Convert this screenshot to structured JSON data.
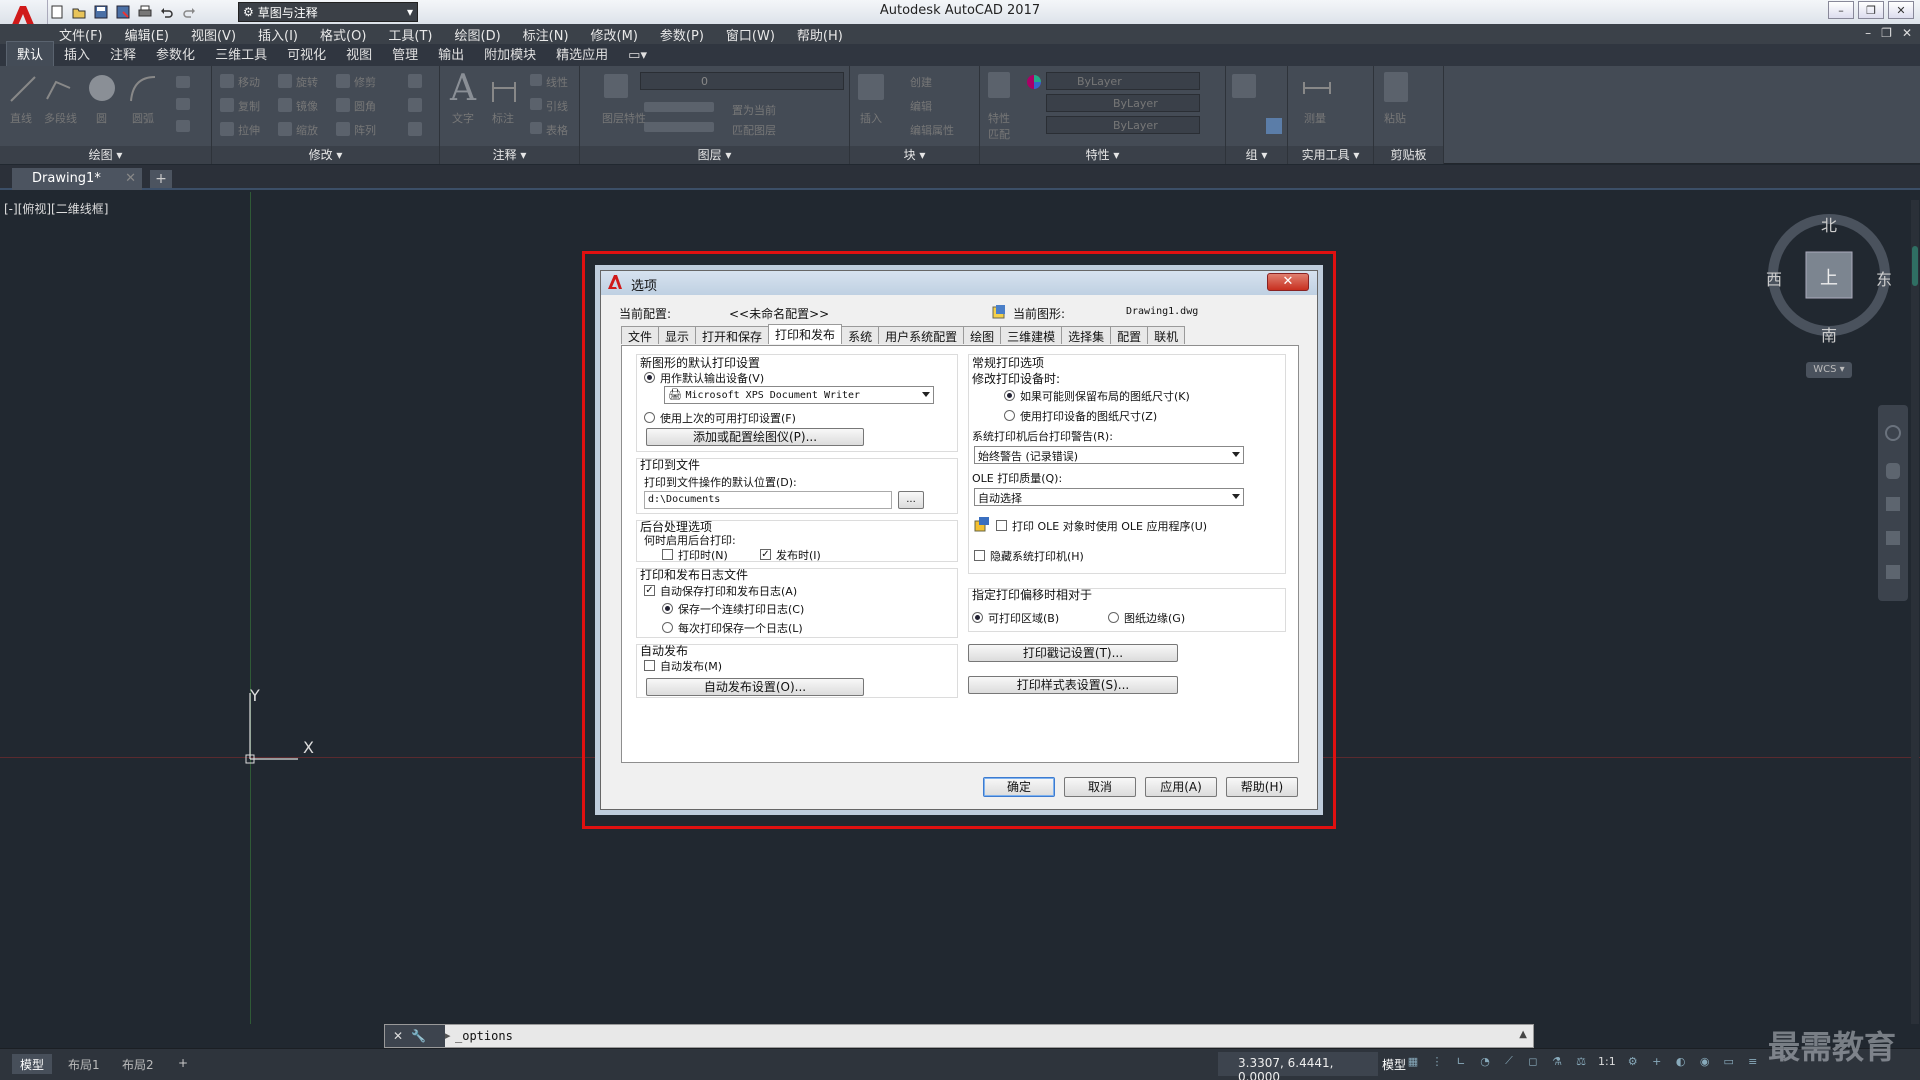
{
  "app": {
    "title": "Autodesk AutoCAD 2017",
    "workspace": "草图与注释"
  },
  "menubar": [
    "文件(F)",
    "编辑(E)",
    "视图(V)",
    "插入(I)",
    "格式(O)",
    "工具(T)",
    "绘图(D)",
    "标注(N)",
    "修改(M)",
    "参数(P)",
    "窗口(W)",
    "帮助(H)"
  ],
  "ribbon": {
    "tabs": [
      "默认",
      "插入",
      "注释",
      "参数化",
      "三维工具",
      "可视化",
      "视图",
      "管理",
      "输出",
      "附加模块",
      "精选应用"
    ],
    "panels": [
      "绘图",
      "修改",
      "注释",
      "图层",
      "块",
      "特性",
      "组",
      "实用工具",
      "剪贴板"
    ],
    "draw_tools": [
      "直线",
      "多段线",
      "圆",
      "圆弧"
    ],
    "modify_tools": [
      "移动",
      "旋转",
      "修剪",
      "复制",
      "镜像",
      "圆角",
      "拉伸",
      "缩放",
      "阵列"
    ],
    "annot_tools": [
      "文字",
      "标注",
      "线性",
      "引线",
      "表格"
    ],
    "layer_tools": [
      "图层特性",
      "置为当前",
      "匹配图层"
    ],
    "layer_value": "0",
    "block_tools": [
      "插入",
      "创建",
      "编辑",
      "编辑属性"
    ],
    "prop_tools": [
      "特性匹配"
    ],
    "prop_values": [
      "ByLayer",
      "ByLayer",
      "ByLayer"
    ],
    "util_tools": [
      "测量"
    ],
    "clip_tools": [
      "粘贴"
    ]
  },
  "filetab": {
    "name": "Drawing1*"
  },
  "viewport_label": "[-][俯视][二维线框]",
  "dialog": {
    "title": "选项",
    "current_profile_label": "当前配置:",
    "current_profile": "<<未命名配置>>",
    "current_drawing_label": "当前图形:",
    "current_drawing": "Drawing1.dwg",
    "tabs": [
      "文件",
      "显示",
      "打开和保存",
      "打印和发布",
      "系统",
      "用户系统配置",
      "绘图",
      "三维建模",
      "选择集",
      "配置",
      "联机"
    ],
    "new_default": {
      "title": "新图形的默认打印设置",
      "opt1": "用作默认输出设备(V)",
      "device": "Microsoft XPS Document Writer",
      "opt2": "使用上次的可用打印设置(F)",
      "add_button": "添加或配置绘图仪(P)..."
    },
    "plot_to_file": {
      "title": "打印到文件",
      "label": "打印到文件操作的默认位置(D):",
      "path": "d:\\Documents",
      "browse": "..."
    },
    "background": {
      "title": "后台处理选项",
      "label": "何时启用后台打印:",
      "plot": "打印时(N)",
      "publish": "发布时(I)"
    },
    "log": {
      "title": "打印和发布日志文件",
      "auto_save": "自动保存打印和发布日志(A)",
      "continuous": "保存一个连续打印日志(C)",
      "per_plot": "每次打印保存一个日志(L)"
    },
    "autopublish": {
      "title": "自动发布",
      "checkbox": "自动发布(M)",
      "button": "自动发布设置(O)..."
    },
    "general": {
      "title": "常规打印选项",
      "label": "修改打印设备时:",
      "opt1": "如果可能则保留布局的图纸尺寸(K)",
      "opt2": "使用打印设备的图纸尺寸(Z)",
      "spool_label": "系统打印机后台打印警告(R):",
      "spool_value": "始终警告 (记录错误)",
      "ole_label": "OLE 打印质量(Q):",
      "ole_value": "自动选择",
      "ole_app": "打印 OLE 对象时使用 OLE 应用程序(U)",
      "hide_sys": "隐藏系统打印机(H)"
    },
    "offset": {
      "title": "指定打印偏移时相对于",
      "printable": "可打印区域(B)",
      "edge": "图纸边缘(G)"
    },
    "stamp_button": "打印戳记设置(T)...",
    "style_button": "打印样式表设置(S)...",
    "buttons": {
      "ok": "确定",
      "cancel": "取消",
      "apply": "应用(A)",
      "help": "帮助(H)"
    }
  },
  "viewcube": {
    "north": "北",
    "south": "南",
    "east": "东",
    "west": "西",
    "top": "上",
    "wcs": "WCS"
  },
  "ucs": {
    "x": "X",
    "y": "Y"
  },
  "command": {
    "text": "_options"
  },
  "status": {
    "layouts": [
      "模型",
      "布局1",
      "布局2"
    ],
    "coords": "3.3307, 6.4441, 0.0000",
    "model": "模型",
    "scale": "1:1"
  },
  "watermark": "最需教育"
}
